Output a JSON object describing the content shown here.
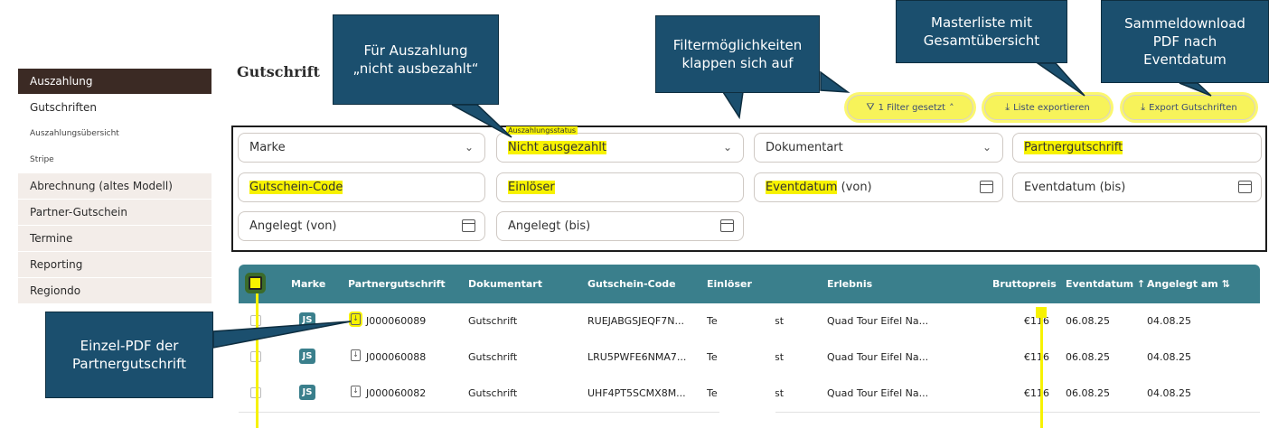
{
  "sidebar": {
    "items": [
      {
        "label": "Auszahlung"
      },
      {
        "label": "Gutschriften"
      },
      {
        "label": "Auszahlungsübersicht"
      },
      {
        "label": "Stripe"
      },
      {
        "label": "Abrechnung (altes Modell)"
      },
      {
        "label": "Partner-Gutschein"
      },
      {
        "label": "Termine"
      },
      {
        "label": "Reporting"
      },
      {
        "label": "Regiondo"
      }
    ]
  },
  "page_title": "Gutschrift",
  "actions": {
    "filter": "1 Filter gesetzt",
    "export_list": "Liste exportieren",
    "export_credits": "Export Gutschriften"
  },
  "filters": {
    "marke": "Marke",
    "status_label": "Auszahlungsstatus",
    "status_value": "Nicht ausgezahlt",
    "dokumentart": "Dokumentart",
    "partnergutschrift": "Partnergutschrift",
    "gutschein_code": "Gutschein-Code",
    "einloeser": "Einlöser",
    "eventdatum_von_hl": "Eventdatum",
    "eventdatum_von_rest": " (von)",
    "eventdatum_bis": "Eventdatum (bis)",
    "angelegt_von": "Angelegt (von)",
    "angelegt_bis": "Angelegt (bis)"
  },
  "table": {
    "headers": {
      "marke": "Marke",
      "partnergutschrift": "Partnergutschrift",
      "dokumentart": "Dokumentart",
      "gutschein_code": "Gutschein-Code",
      "einloeser": "Einlöser",
      "erlebnis": "Erlebnis",
      "bruttopreis": "Bruttopreis",
      "eventdatum": "Eventdatum ↑",
      "angelegt_am": "Angelegt am ⇅"
    },
    "rows": [
      {
        "brand": "JS",
        "id": "J000060089",
        "type": "Gutschrift",
        "code": "RUEJABGSJEQF7N...",
        "einl_a": "Te",
        "einl_b": "st",
        "erlebnis": "Quad Tour Eifel Na...",
        "preis": "€116",
        "event": "06.08.25",
        "angelegt": "04.08.25"
      },
      {
        "brand": "JS",
        "id": "J000060088",
        "type": "Gutschrift",
        "code": "LRU5PWFE6NMA7...",
        "einl_a": "Te",
        "einl_b": "st",
        "erlebnis": "Quad Tour Eifel Na...",
        "preis": "€116",
        "event": "06.08.25",
        "angelegt": "04.08.25"
      },
      {
        "brand": "JS",
        "id": "J000060082",
        "type": "Gutschrift",
        "code": "UHF4PT5SCMX8M...",
        "einl_a": "Te",
        "einl_b": "st",
        "erlebnis": "Quad Tour Eifel Na...",
        "preis": "€116",
        "event": "06.08.25",
        "angelegt": "04.08.25"
      }
    ]
  },
  "callouts": {
    "auszahlung": "Für Auszahlung\n„nicht ausbezahlt“",
    "filter": "Filtermöglichkeiten\nklappen sich auf",
    "masterliste": "Masterliste mit\nGesamtübersicht",
    "sammel": "Sammeldownload\nPDF nach\nEventdatum",
    "einzel": "Einzel-PDF der\nPartnergutschrift"
  },
  "colors": {
    "header_teal": "#3a7f8c",
    "callout_blue": "#1b4f6e",
    "highlight_yellow": "#f7f200",
    "sidebar_active": "#3b2a24"
  }
}
